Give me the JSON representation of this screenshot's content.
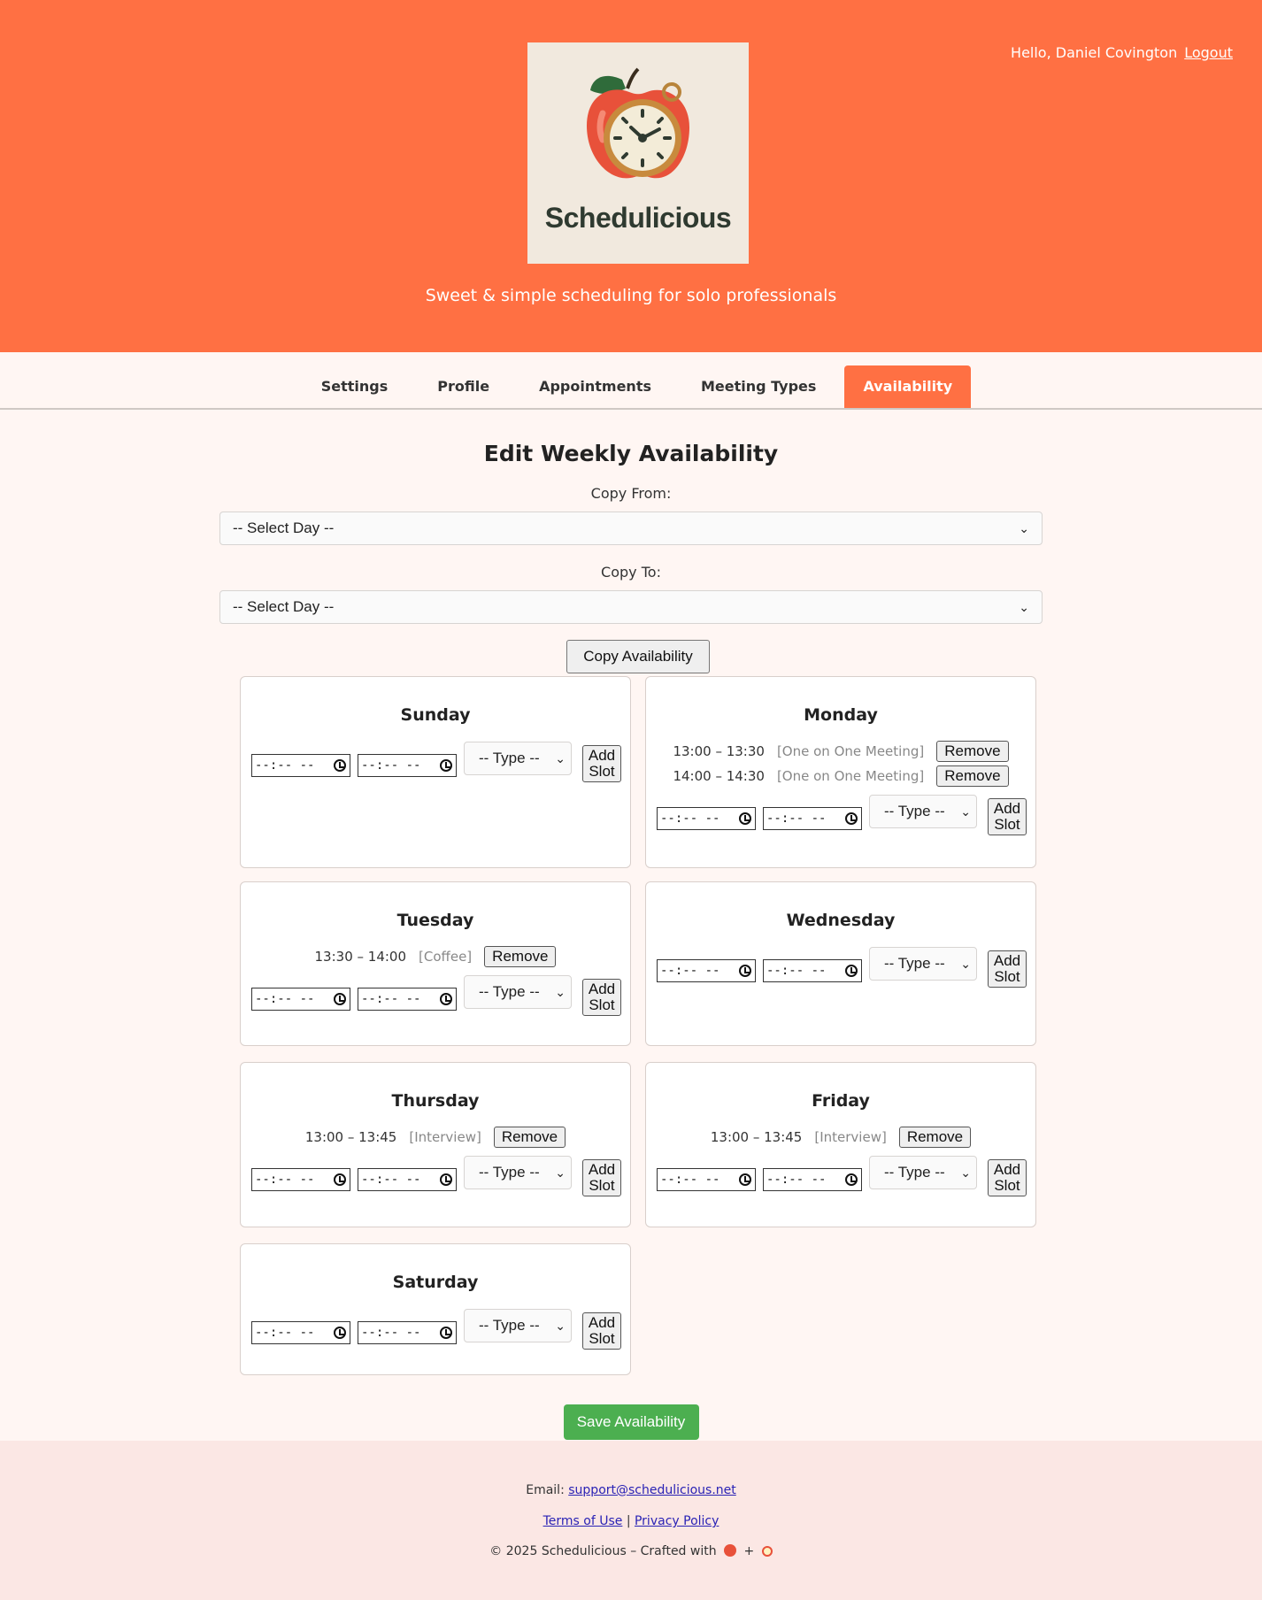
{
  "header": {
    "greeting": "Hello, Daniel Covington",
    "logout": "Logout",
    "logo_text": "Schedulicious",
    "tagline": "Sweet & simple scheduling for solo professionals",
    "bg_color": "#ff7043"
  },
  "nav": {
    "tabs": [
      {
        "label": "Settings",
        "active": false
      },
      {
        "label": "Profile",
        "active": false
      },
      {
        "label": "Appointments",
        "active": false
      },
      {
        "label": "Meeting Types",
        "active": false
      },
      {
        "label": "Availability",
        "active": true
      }
    ]
  },
  "main": {
    "title": "Edit Weekly Availability",
    "copy_from_label": "Copy From:",
    "copy_to_label": "Copy To:",
    "select_day_value": "-- Select Day --",
    "copy_button": "Copy Availability",
    "save_button": "Save Availability",
    "save_color": "#4caf50"
  },
  "controls": {
    "time_placeholder": "--:-- --",
    "type_placeholder": "-- Type --",
    "add_slot_line1": "Add",
    "add_slot_line2": "Slot",
    "remove_label": "Remove"
  },
  "days": [
    {
      "name": "Sunday",
      "slots": []
    },
    {
      "name": "Monday",
      "slots": [
        {
          "time": "13:00 – 13:30",
          "type": "[One on One Meeting]"
        },
        {
          "time": "14:00 – 14:30",
          "type": "[One on One Meeting]"
        }
      ]
    },
    {
      "name": "Tuesday",
      "slots": [
        {
          "time": "13:30 – 14:00",
          "type": "[Coffee]"
        }
      ]
    },
    {
      "name": "Wednesday",
      "slots": []
    },
    {
      "name": "Thursday",
      "slots": [
        {
          "time": "13:00 – 13:45",
          "type": "[Interview]"
        }
      ]
    },
    {
      "name": "Friday",
      "slots": [
        {
          "time": "13:00 – 13:45",
          "type": "[Interview]"
        }
      ]
    },
    {
      "name": "Saturday",
      "slots": []
    }
  ],
  "footer": {
    "email_label": "Email:",
    "email": "support@schedulicious.net",
    "terms": "Terms of Use",
    "separator": "|",
    "privacy": "Privacy Policy",
    "copyright": "© 2025 Schedulicious – Crafted with",
    "plus": "+"
  }
}
